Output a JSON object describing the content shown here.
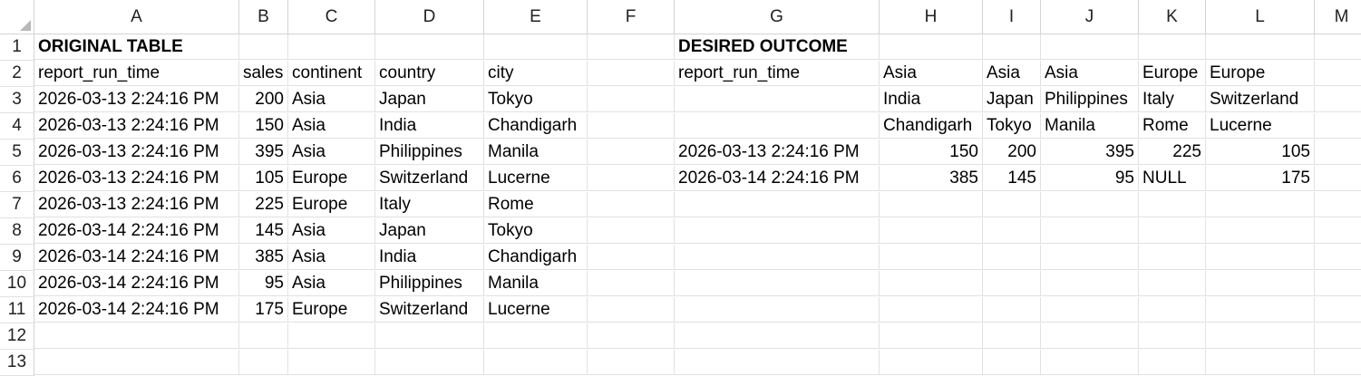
{
  "columns": [
    "A",
    "B",
    "C",
    "D",
    "E",
    "F",
    "G",
    "H",
    "I",
    "J",
    "K",
    "L",
    "M"
  ],
  "rows": [
    "1",
    "2",
    "3",
    "4",
    "5",
    "6",
    "7",
    "8",
    "9",
    "10",
    "11",
    "12",
    "13"
  ],
  "cells": {
    "A1": "ORIGINAL TABLE",
    "A2": "report_run_time",
    "B2": "sales",
    "C2": "continent",
    "D2": "country",
    "E2": "city",
    "A3": "2026-03-13  2:24:16 PM",
    "B3": "200",
    "C3": "Asia",
    "D3": "Japan",
    "E3": "Tokyo",
    "A4": "2026-03-13  2:24:16 PM",
    "B4": "150",
    "C4": "Asia",
    "D4": "India",
    "E4": "Chandigarh",
    "A5": "2026-03-13  2:24:16 PM",
    "B5": "395",
    "C5": "Asia",
    "D5": "Philippines",
    "E5": "Manila",
    "A6": "2026-03-13  2:24:16 PM",
    "B6": "105",
    "C6": "Europe",
    "D6": "Switzerland",
    "E6": "Lucerne",
    "A7": "2026-03-13  2:24:16 PM",
    "B7": "225",
    "C7": "Europe",
    "D7": "Italy",
    "E7": "Rome",
    "A8": "2026-03-14  2:24:16 PM",
    "B8": "145",
    "C8": "Asia",
    "D8": "Japan",
    "E8": "Tokyo",
    "A9": "2026-03-14  2:24:16 PM",
    "B9": "385",
    "C9": "Asia",
    "D9": "India",
    "E9": "Chandigarh",
    "A10": "2026-03-14  2:24:16 PM",
    "B10": "95",
    "C10": "Asia",
    "D10": "Philippines",
    "E10": "Manila",
    "A11": "2026-03-14  2:24:16 PM",
    "B11": "175",
    "C11": "Europe",
    "D11": "Switzerland",
    "E11": "Lucerne",
    "G1": "DESIRED OUTCOME",
    "G2": "report_run_time",
    "H2": "Asia",
    "I2": "Asia",
    "J2": "Asia",
    "K2": "Europe",
    "L2": "Europe",
    "H3": "India",
    "I3": "Japan",
    "J3": "Philippines",
    "K3": "Italy",
    "L3": "Switzerland",
    "H4": "Chandigarh",
    "I4": "Tokyo",
    "J4": "Manila",
    "K4": "Rome",
    "L4": "Lucerne",
    "G5": "2026-03-13  2:24:16 PM",
    "H5": "150",
    "I5": "200",
    "J5": "395",
    "K5": "225",
    "L5": "105",
    "G6": "2026-03-14  2:24:16 PM",
    "H6": "385",
    "I6": "145",
    "J6": "95",
    "K6": "NULL",
    "L6": "175"
  }
}
